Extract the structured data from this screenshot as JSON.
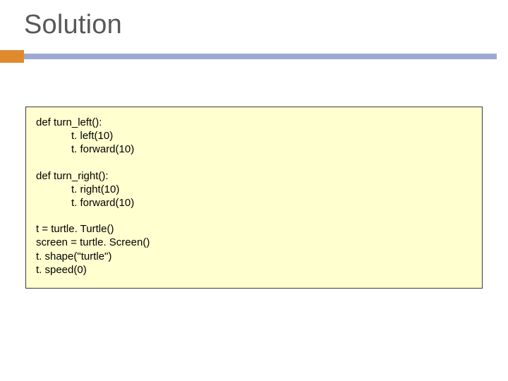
{
  "title": "Solution",
  "code": {
    "group1": "def turn_left():\n            t. left(10)\n            t. forward(10)",
    "group2": "def turn_right():\n            t. right(10)\n            t. forward(10)",
    "group3": "t = turtle. Turtle()\nscreen = turtle. Screen()\nt. shape(\"turtle\")\nt. speed(0)"
  }
}
